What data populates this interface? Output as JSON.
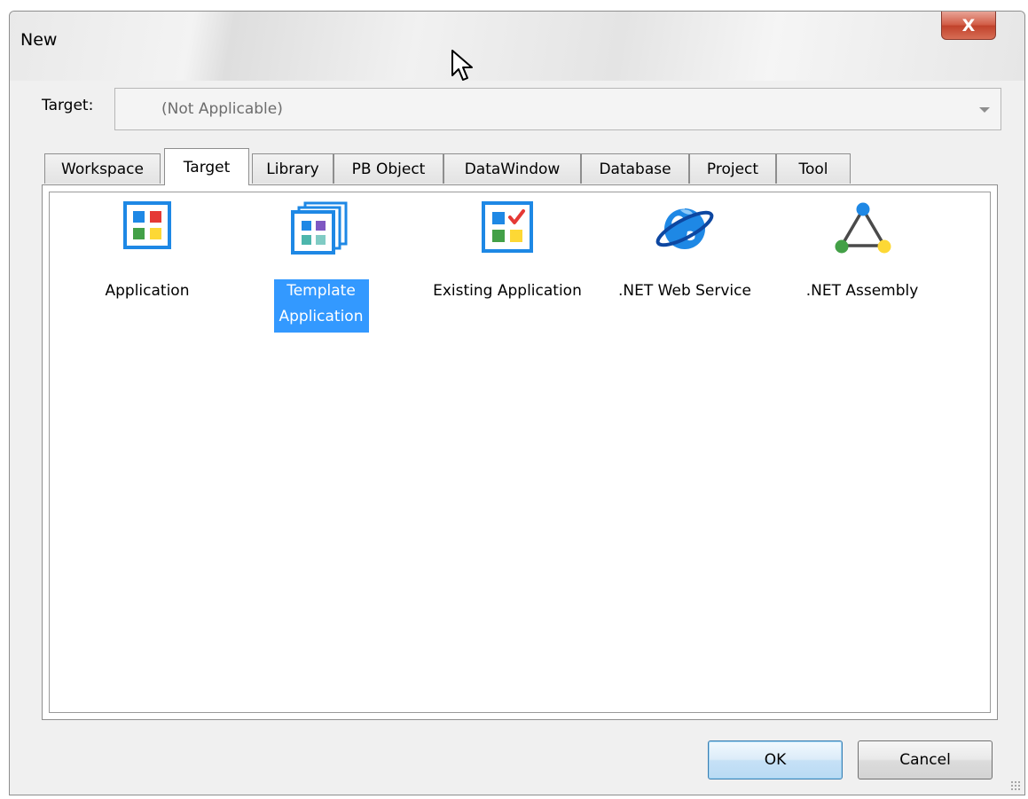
{
  "window": {
    "title": "New",
    "close_glyph": "X"
  },
  "target": {
    "label": "Target:",
    "value": "(Not Applicable)"
  },
  "tabs": [
    {
      "label": "Workspace",
      "active": false
    },
    {
      "label": "Target",
      "active": true
    },
    {
      "label": "Library",
      "active": false
    },
    {
      "label": "PB Object",
      "active": false
    },
    {
      "label": "DataWindow",
      "active": false
    },
    {
      "label": "Database",
      "active": false
    },
    {
      "label": "Project",
      "active": false
    },
    {
      "label": "Tool",
      "active": false
    }
  ],
  "items": [
    {
      "label": "Application",
      "icon": "application-icon",
      "selected": false
    },
    {
      "label": "Template Application",
      "label_line1": "Template",
      "label_line2": "Application",
      "icon": "template-application-icon",
      "selected": true
    },
    {
      "label": "Existing Application",
      "icon": "existing-application-icon",
      "selected": false
    },
    {
      "label": ".NET Web Service",
      "icon": "globe-icon",
      "selected": false
    },
    {
      "label": ".NET Assembly",
      "icon": "assembly-triangle-icon",
      "selected": false
    }
  ],
  "buttons": {
    "ok": "OK",
    "cancel": "Cancel"
  },
  "colors": {
    "selection": "#3399ff",
    "icon_frame": "#1e88e5",
    "tile_blue": "#1e88e5",
    "tile_red": "#e53935",
    "tile_green": "#43a047",
    "tile_yellow": "#fdd835",
    "tile_purple": "#7e57c2",
    "tile_teal": "#4db6ac"
  }
}
